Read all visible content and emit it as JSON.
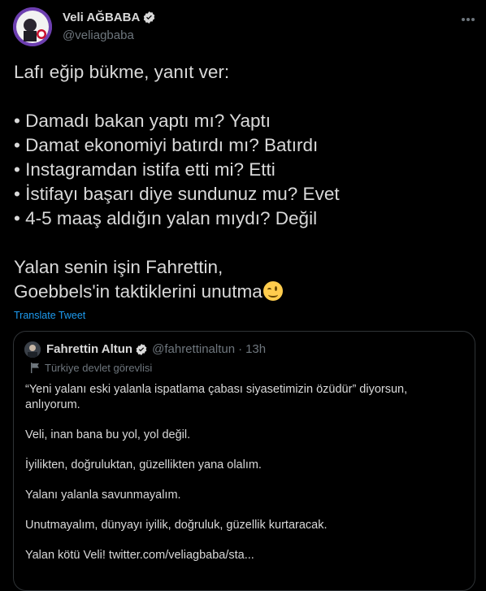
{
  "author": {
    "name": "Veli AĞBABA",
    "handle": "@veliagbaba"
  },
  "tweet": {
    "lines": [
      "Lafı eğip bükme, yanıt ver:",
      "",
      "• Damadı bakan yaptı mı? Yaptı",
      "• Damat ekonomiyi batırdı mı? Batırdı",
      "• Instagramdan istifa etti mi? Etti",
      "• İstifayı başarı diye sundunuz mu? Evet",
      "• 4-5 maaş aldığın yalan mıydı? Değil",
      "",
      "Yalan senin işin Fahrettin,",
      "Goebbels'in taktiklerini unutma"
    ],
    "emoji": "winking-face-emoji",
    "translate_label": "Translate Tweet"
  },
  "quoted": {
    "name": "Fahrettin Altun",
    "handle": "@fahrettinaltun",
    "separator": "·",
    "time": "13h",
    "label": "Türkiye devlet görevlisi",
    "paragraphs": [
      "“Yeni yalanı eski yalanla ispatlama çabası siyasetimizin özüdür” diyorsun, anlıyorum.",
      "Veli, inan bana bu yol, yol değil.",
      "İyilikten, doğruluktan, güzellikten yana olalım.",
      "Yalanı yalanla savunmayalım.",
      "Unutmayalım, dünyayı iyilik, doğruluk, güzellik kurtaracak.",
      "Yalan kötü Veli! twitter.com/veliagbaba/sta..."
    ]
  },
  "colors": {
    "background": "#000000",
    "text": "#d9d9d9",
    "secondary": "#6e767d",
    "accent": "#1d9bf0",
    "border": "#2f3336"
  }
}
